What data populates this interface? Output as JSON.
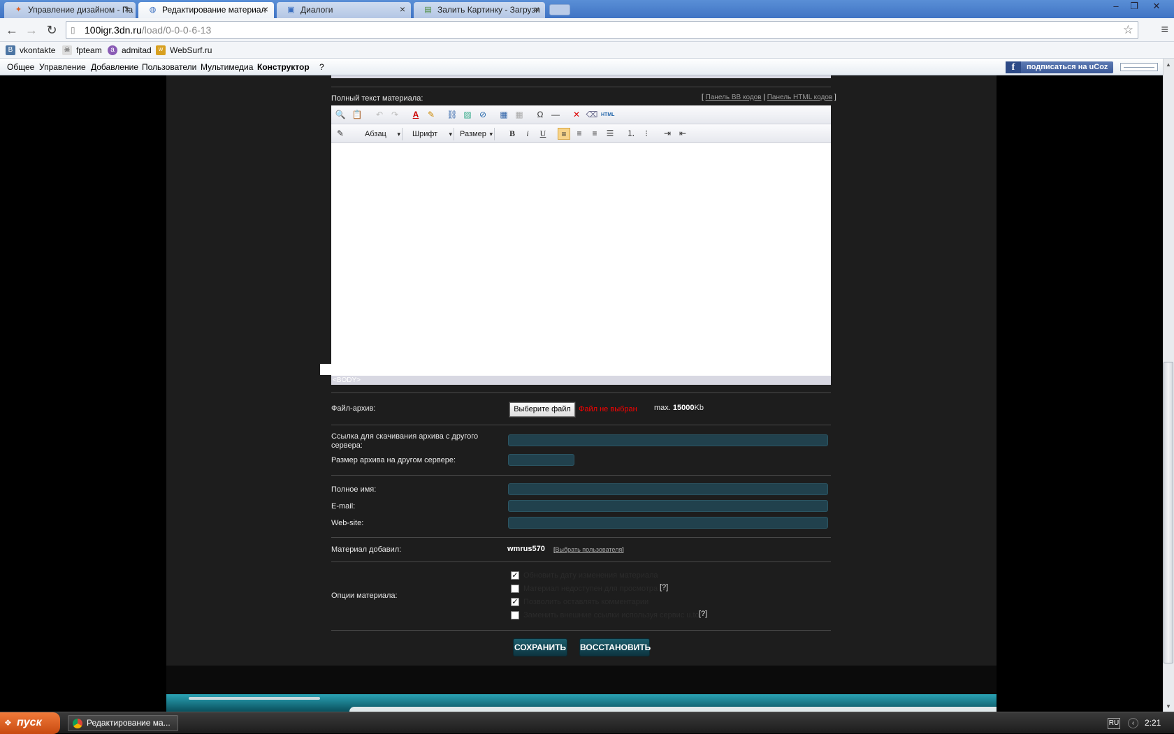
{
  "browser": {
    "tabs": [
      {
        "label": "Управление дизайном - Па",
        "icon": "ucoz-icon"
      },
      {
        "label": "Редактирование материал",
        "icon": "ucoz-icon"
      },
      {
        "label": "Диалоги",
        "icon": "chat-icon"
      },
      {
        "label": "Залить Картинку - Загрузи",
        "icon": "image-icon"
      }
    ],
    "url_host": "100igr.3dn.ru",
    "url_path": "/load/0-0-0-6-13",
    "bookmarks": [
      {
        "label": "vkontakte",
        "icon": "vk-icon"
      },
      {
        "label": "fpteam",
        "icon": "skull-icon"
      },
      {
        "label": "admitad",
        "icon": "admitad-icon"
      },
      {
        "label": "WebSurf.ru",
        "icon": "websurf-icon"
      }
    ]
  },
  "ucoz_bar": {
    "menu": [
      "Общее",
      "Управление",
      "Добавление",
      "Пользователи",
      "Мультимедиа",
      "Конструктор",
      "?"
    ],
    "subscribe": "подписаться на uCoz"
  },
  "form": {
    "fulltext_label": "Полный текст материала:",
    "bb_panel_link": "Панель BB кодов",
    "html_panel_link": "Панель HTML кодов",
    "bracket_open": "[",
    "bracket_sep": "|",
    "bracket_close": "]",
    "editor": {
      "paragraph": "Абзац",
      "font": "Шрифт",
      "size": "Размер",
      "status": "<BODY>"
    },
    "file_label": "Файл-архив:",
    "file_button": "Выберите файл",
    "file_none": "Файл не выбран",
    "max_prefix": "max.",
    "max_value": "15000",
    "max_unit": "Kb",
    "remote_link_label": "Ссылка для скачивания архива с другого сервера:",
    "remote_size_label": "Размер архива на другом сервере:",
    "fullname_label": "Полное имя:",
    "email_label": "E-mail:",
    "website_label": "Web-site:",
    "added_by_label": "Материал добавил:",
    "added_by_user": "wmrus570",
    "choose_user_link": "Выбрать пользователя",
    "options_label": "Опции материала:",
    "options": [
      {
        "label": "Обновить дату изменения материала",
        "checked": true
      },
      {
        "label": "Материал недоступен для просмотра",
        "checked": false,
        "help": "[?]"
      },
      {
        "label": "Позволить оставлять комментарии",
        "checked": true
      },
      {
        "label": "Заменить внешние ссылки используя сервис u.to",
        "checked": false,
        "help": "[?]"
      }
    ],
    "save_button": "СОХРАНИТЬ",
    "restore_button": "ВОССТАНОВИТЬ"
  },
  "taskbar": {
    "start": "пуск",
    "task": "Редактирование ма...",
    "lang": "RU",
    "clock": "2:21"
  },
  "colors": {
    "page_bg": "#1d1d1d",
    "input_bg": "#21414d",
    "button_bg": "#0d3440",
    "error_text": "#ff0000"
  }
}
